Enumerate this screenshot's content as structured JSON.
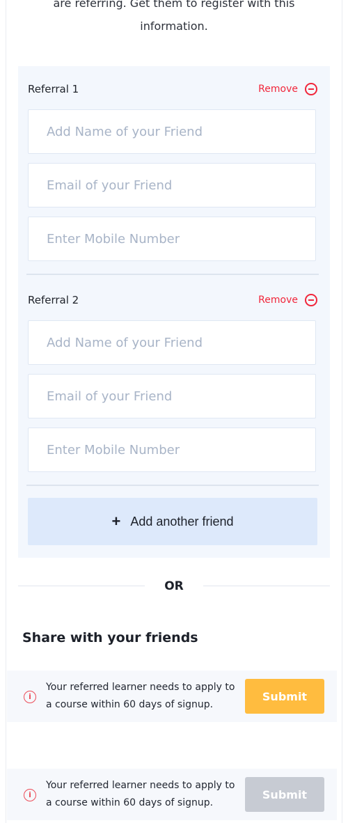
{
  "intro": {
    "text": "are referring. Get them to register with this information."
  },
  "referrals": [
    {
      "title": "Referral 1",
      "remove_label": "Remove",
      "name_placeholder": "Add Name of your Friend",
      "email_placeholder": "Email of your Friend",
      "mobile_placeholder": "Enter Mobile Number"
    },
    {
      "title": "Referral 2",
      "remove_label": "Remove",
      "name_placeholder": "Add Name of your Friend",
      "email_placeholder": "Email of your Friend",
      "mobile_placeholder": "Enter Mobile Number"
    }
  ],
  "actions": {
    "add_friend_label": "Add another friend",
    "or_label": "OR",
    "share_title": "Share with your friends"
  },
  "notices": [
    {
      "text": "Your referred learner needs to apply to a course within 60 days of signup.",
      "submit_label": "Submit",
      "submit_state": "active"
    },
    {
      "text": "Your referred learner needs to apply to a course within 60 days of signup.",
      "submit_label": "Submit",
      "submit_state": "disabled"
    }
  ],
  "colors": {
    "remove": "#f1263b",
    "submit_active": "#ffbc3f",
    "submit_disabled": "#c7cbd3",
    "panel_bg": "#f3f7fd",
    "add_button_bg": "#dde9fb"
  },
  "icons": {
    "remove": "minus-circle-icon",
    "add": "plus-icon",
    "notice": "info-icon"
  }
}
